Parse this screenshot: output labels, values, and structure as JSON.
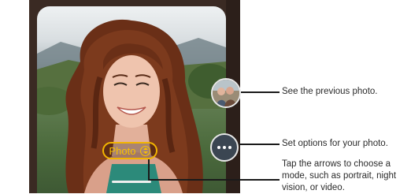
{
  "camera": {
    "mode_label": "Photo"
  },
  "callouts": {
    "previous_photo": "See the previous photo.",
    "options": "Set options for your photo.",
    "mode_line1": "Tap the arrows to choose a",
    "mode_line2": "mode, such as portrait, night",
    "mode_line3": "vision, or video."
  },
  "icons": {
    "thumbnail": "previous-photo-thumbnail-icon",
    "options": "more-options-icon",
    "mode_switch": "up-down-arrows-icon"
  },
  "colors": {
    "mode_accent": "#f2b400",
    "options_button": "#3b4652",
    "callout_line": "#1a1a1a"
  }
}
